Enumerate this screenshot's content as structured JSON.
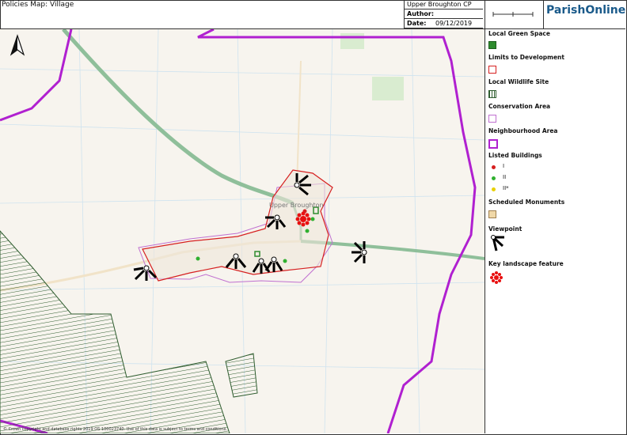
{
  "header": {
    "title": "Policies Map: Village",
    "parish": "Upper Broughton CP",
    "author_label": "Author:",
    "author_value": "",
    "date_label": "Date:",
    "date_value": "09/12/2019",
    "brand": "ParishOnline"
  },
  "legend": {
    "items": [
      {
        "label": "Local Green Space"
      },
      {
        "label": "Limits to Development"
      },
      {
        "label": "Local Wildlife Site"
      },
      {
        "label": "Conservation Area"
      },
      {
        "label": "Neighbourhood Area"
      },
      {
        "label": "Listed Buildings"
      },
      {
        "label": "Scheduled Monuments"
      },
      {
        "label": "Viewpoint"
      },
      {
        "label": "Key landscape feature"
      }
    ],
    "listed_grades": [
      "I",
      "II",
      "II*"
    ],
    "colors": {
      "green_space": "#2e8b2e",
      "limits": "#d62020",
      "wildlife": "#2f5d2f",
      "conservation": "#c070d0",
      "neighbourhood": "#b020d0",
      "grade_I": "#d62020",
      "grade_II": "#30b030",
      "grade_IIstar": "#e8d000",
      "monument": "#f0d8a8"
    }
  },
  "map": {
    "place_label": "Upper Broughton",
    "copyright": "© Crown copyright and database rights 2019 OS 100023740. Use of this data is subject to terms and conditions."
  }
}
